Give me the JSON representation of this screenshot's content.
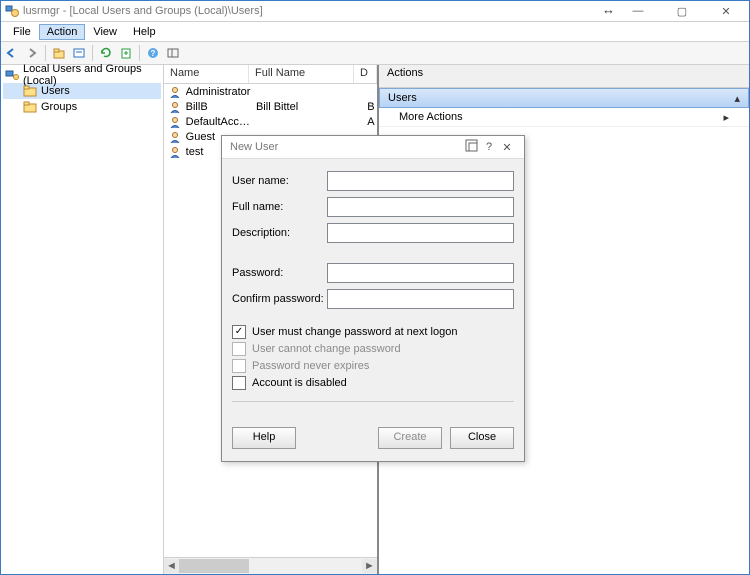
{
  "title": "lusrmgr - [Local Users and Groups (Local)\\Users]",
  "menu": {
    "file": "File",
    "action": "Action",
    "view": "View",
    "help": "Help"
  },
  "tree": {
    "root": "Local Users and Groups (Local)",
    "users": "Users",
    "groups": "Groups"
  },
  "columns": {
    "name": "Name",
    "full": "Full Name",
    "desc": "D"
  },
  "users": [
    {
      "name": "Administrator",
      "full": "",
      "d": ""
    },
    {
      "name": "BillB",
      "full": "Bill Bittel",
      "d": "B"
    },
    {
      "name": "DefaultAcco...",
      "full": "",
      "d": "A"
    },
    {
      "name": "Guest",
      "full": "",
      "d": ""
    },
    {
      "name": "test",
      "full": "",
      "d": ""
    }
  ],
  "actions": {
    "header": "Actions",
    "users": "Users",
    "more": "More Actions"
  },
  "dialog": {
    "title": "New User",
    "username": "User name:",
    "fullname": "Full name:",
    "description": "Description:",
    "password": "Password:",
    "confirm": "Confirm password:",
    "mustchange": "User must change password at next logon",
    "cannotchange": "User cannot change password",
    "neverexpires": "Password never expires",
    "disabled": "Account is disabled",
    "help": "Help",
    "create": "Create",
    "close": "Close"
  }
}
